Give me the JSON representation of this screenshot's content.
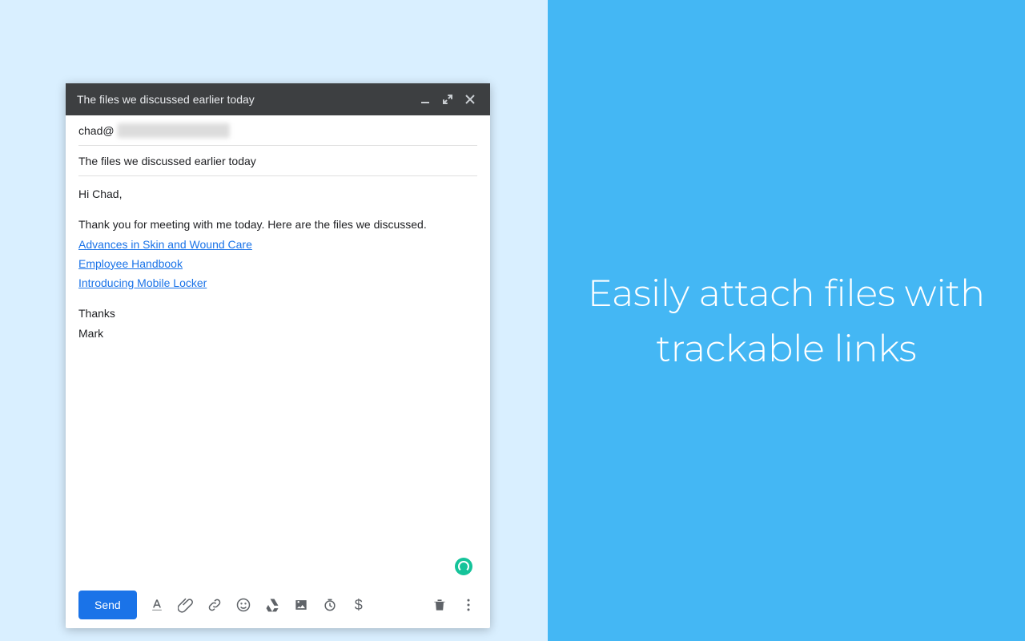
{
  "promo": {
    "headline": "Easily attach files with trackable links"
  },
  "compose": {
    "title": "The files we discussed earlier today",
    "recipient_prefix": "chad@",
    "subject": "The files we discussed earlier today",
    "body": {
      "greeting": "Hi Chad,",
      "intro": "Thank you for meeting with me today. Here are the files we discussed.",
      "links": [
        "Advances in Skin and Wound Care",
        "Employee Handbook",
        "Introducing Mobile Locker"
      ],
      "signoff1": "Thanks",
      "signoff2": "Mark"
    },
    "send_label": "Send"
  }
}
